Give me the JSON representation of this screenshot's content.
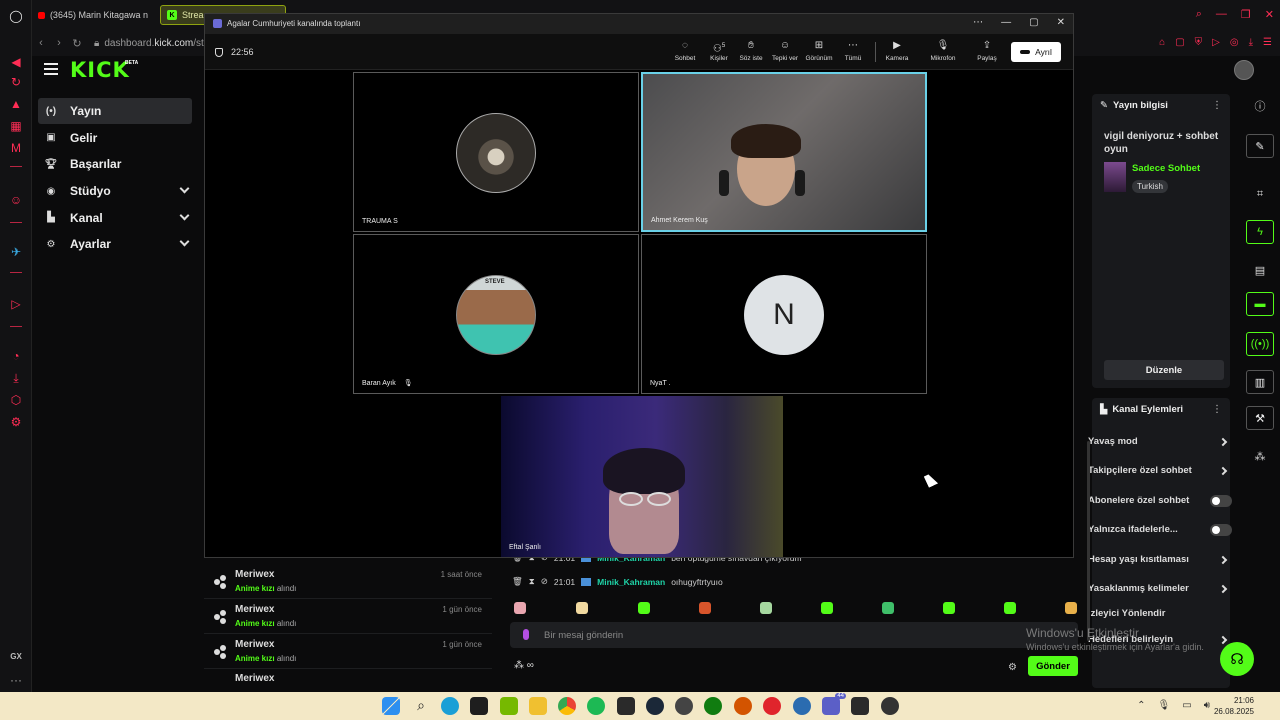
{
  "browser": {
    "tabs": [
      {
        "label": "(3645) Marin Kitagawa n"
      },
      {
        "label": "Stream"
      }
    ],
    "url": {
      "host": "dashboard.",
      "domain": "kick.com",
      "path": "/st"
    },
    "gx_label": "GX"
  },
  "kick": {
    "logo": "KICK",
    "beta": "BETA",
    "nav": [
      {
        "label": "Yayın",
        "icon": "broadcast-icon"
      },
      {
        "label": "Gelir",
        "icon": "revenue-icon"
      },
      {
        "label": "Başarılar",
        "icon": "trophy-icon"
      },
      {
        "label": "Stüdyo",
        "icon": "studio-icon"
      },
      {
        "label": "Kanal",
        "icon": "channel-icon"
      },
      {
        "label": "Ayarlar",
        "icon": "settings-gear-icon"
      }
    ],
    "activity": [
      {
        "name": "Meriwex",
        "item": "Anime kızı",
        "action": "alındı",
        "time": "1 saat önce"
      },
      {
        "name": "Meriwex",
        "item": "Anime kızı",
        "action": "alındı",
        "time": "1 gün önce"
      },
      {
        "name": "Meriwex",
        "item": "Anime kızı",
        "action": "alındı",
        "time": "1 gün önce"
      },
      {
        "name": "Meriwex"
      }
    ],
    "chat": {
      "lines": [
        {
          "time": "21:01",
          "user": "Minik_Kahraman",
          "message": "ben öptüğüme sınavdan çıkıyorum"
        },
        {
          "time": "21:01",
          "user": "Minik_Kahraman",
          "message": "oıhugyftrtyuıo"
        }
      ],
      "placeholder": "Bir mesaj gönderin",
      "send_label": "Gönder",
      "infinity": "∞"
    },
    "stream_info": {
      "heading": "Yayın bilgisi",
      "title": "vigil deniyoruz + sohbet oyun",
      "category": "Sadece Sohbet",
      "language": "Turkish",
      "edit_label": "Düzenle"
    },
    "channel_actions": {
      "heading": "Kanal Eylemleri",
      "items": [
        {
          "label": "Yavaş mod",
          "control": "chevron"
        },
        {
          "label": "Takipçilere özel sohbet",
          "control": "chevron"
        },
        {
          "label": "Abonelere özel sohbet",
          "control": "toggle",
          "enabled": false
        },
        {
          "label": "Yalnızca ifadelerle...",
          "control": "toggle",
          "enabled": false
        },
        {
          "label": "Hesap yaşı kısıtlaması",
          "control": "chevron"
        },
        {
          "label": "Yasaklanmış kelimeler",
          "control": "chevron"
        },
        {
          "label": "İzleyici Yönlendir",
          "control": "none"
        },
        {
          "label": "Hedefleri belirleyin",
          "control": "chevron"
        }
      ]
    }
  },
  "meeting": {
    "window_title": "Agalar Cumhuriyeti kanalında toplantı",
    "timer": "22:56",
    "toolbar": [
      {
        "label": "Sohbet",
        "icon": "chat-bubble-icon"
      },
      {
        "label": "Kişiler",
        "icon": "people-icon",
        "count": "5"
      },
      {
        "label": "Söz iste",
        "icon": "raise-hand-icon"
      },
      {
        "label": "Tepki ver",
        "icon": "emoji-icon"
      },
      {
        "label": "Görünüm",
        "icon": "grid-view-icon"
      },
      {
        "label": "Tümü",
        "icon": "more-icon"
      },
      {
        "label": "Kamera",
        "icon": "camera-off-icon"
      },
      {
        "label": "Mikrofon",
        "icon": "microphone-icon"
      },
      {
        "label": "Paylaş",
        "icon": "share-screen-icon"
      }
    ],
    "leave_label": "Ayrıl",
    "participants": [
      {
        "name": "TRAUMA S",
        "speaking": false
      },
      {
        "name": "Ahmet Kerem Kuş",
        "speaking": true
      },
      {
        "name": "Baran Ayık",
        "speaking": false,
        "muted": true
      },
      {
        "name": "NyaT .",
        "speaking": false,
        "initial": "N"
      },
      {
        "name": "Eftal Şanlı",
        "speaking": false
      }
    ],
    "steve_label": "STEVE"
  },
  "watermark": {
    "line1": "Windows'u Etkinleştir",
    "line2": "Windows'u etkinleştirmek için Ayarlar'a gidin."
  },
  "taskbar": {
    "time": "21:06",
    "date": "26.08.2025",
    "teams_badge": "44"
  },
  "colors": {
    "kick_green": "#53fc18",
    "speaking_border": "#6ad1e8",
    "gx_accent": "#ff2d55",
    "taskbar": "#f3e8c6"
  }
}
